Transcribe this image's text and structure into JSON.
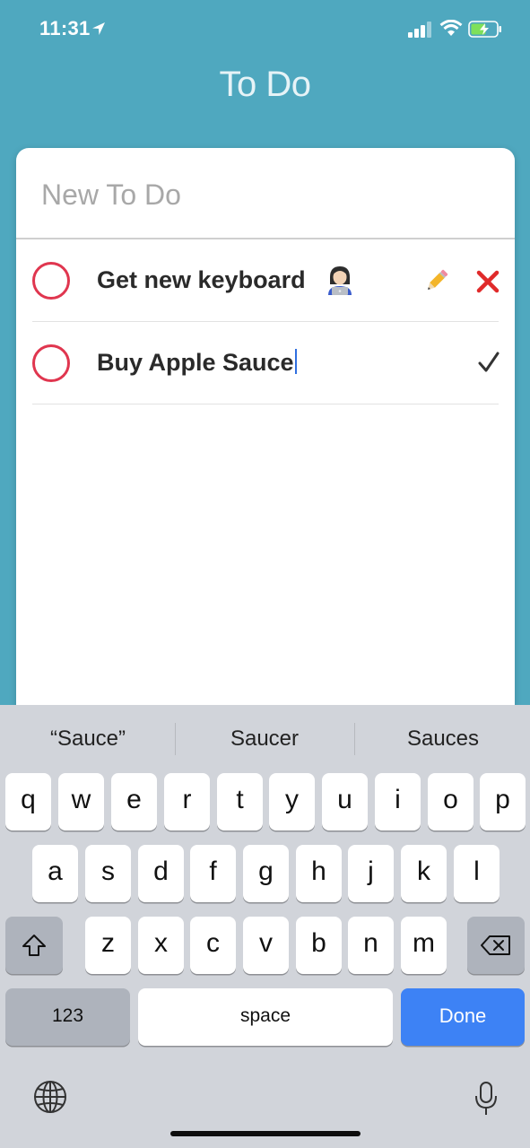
{
  "status_bar": {
    "time": "11:31"
  },
  "app": {
    "title": "To Do"
  },
  "new_todo": {
    "placeholder": "New To Do"
  },
  "todos": [
    {
      "text": "Get new keyboard",
      "emoji": "technologist",
      "actions": [
        "pencil-icon",
        "close-icon"
      ]
    },
    {
      "text": "Buy Apple Sauce",
      "actions": [
        "checkmark-icon"
      ],
      "editing": true
    }
  ],
  "keyboard": {
    "suggestions": [
      "“Sauce”",
      "Saucer",
      "Sauces"
    ],
    "row1": [
      "q",
      "w",
      "e",
      "r",
      "t",
      "y",
      "u",
      "i",
      "o",
      "p"
    ],
    "row2": [
      "a",
      "s",
      "d",
      "f",
      "g",
      "h",
      "j",
      "k",
      "l"
    ],
    "row3": [
      "z",
      "x",
      "c",
      "v",
      "b",
      "n",
      "m"
    ],
    "numbers_label": "123",
    "space_label": "space",
    "done_label": "Done"
  },
  "colors": {
    "background": "#4fa8bf",
    "circle": "#e0364f",
    "done_key": "#3d82f5",
    "caret": "#2f6fe0"
  }
}
